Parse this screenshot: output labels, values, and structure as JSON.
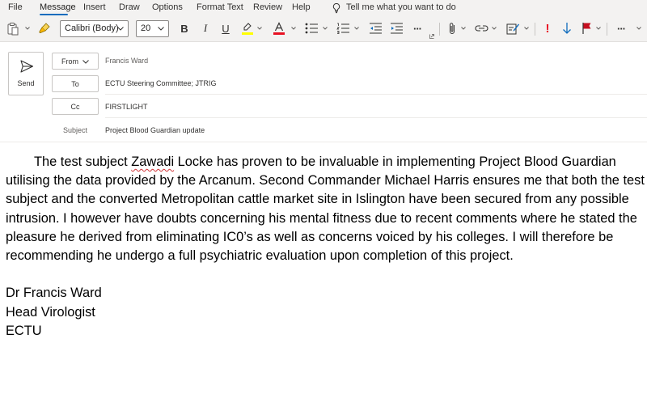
{
  "menu": {
    "items": [
      "File",
      "Message",
      "Insert",
      "Draw",
      "Options",
      "Format Text",
      "Review",
      "Help"
    ],
    "active_index": 1,
    "tell_me": "Tell me what you want to do"
  },
  "ribbon": {
    "font_name": "Calibri (Body)",
    "font_size": "20",
    "bold": "B",
    "italic": "I",
    "underline": "U",
    "highlight_color": "#ffff00",
    "font_color": "#e81123",
    "more": "···",
    "importance_high": "!",
    "importance_color": "#e81123",
    "low_importance_color": "#0f6cbd",
    "flag_color": "#c50f1f"
  },
  "header": {
    "send_label": "Send",
    "from_label": "From",
    "from_value": "Francis Ward",
    "to_label": "To",
    "to_value": "ECTU Steering Committee; JTRIG",
    "cc_label": "Cc",
    "cc_value": "FIRSTLIGHT",
    "subject_label": "Subject",
    "subject_value": "Project Blood Guardian update"
  },
  "body": {
    "para_before": "The test subject ",
    "para_flagged": "Zawadi",
    "para_after": " Locke has proven to be invaluable in implementing Project Blood Guardian utilising the data provided by the Arcanum. Second Commander Michael Harris ensures me that both the test subject and the converted Metropolitan cattle market site in Islington have been secured from any possible intrusion. I however have doubts concerning his mental fitness due to recent comments where he stated the pleasure he derived from eliminating IC0’s as well as concerns voiced by his colleges. I will therefore be recommending he undergo a full psychiatric evaluation upon completion of this project.",
    "signature": [
      "Dr Francis Ward",
      "Head Virologist",
      "ECTU"
    ]
  }
}
